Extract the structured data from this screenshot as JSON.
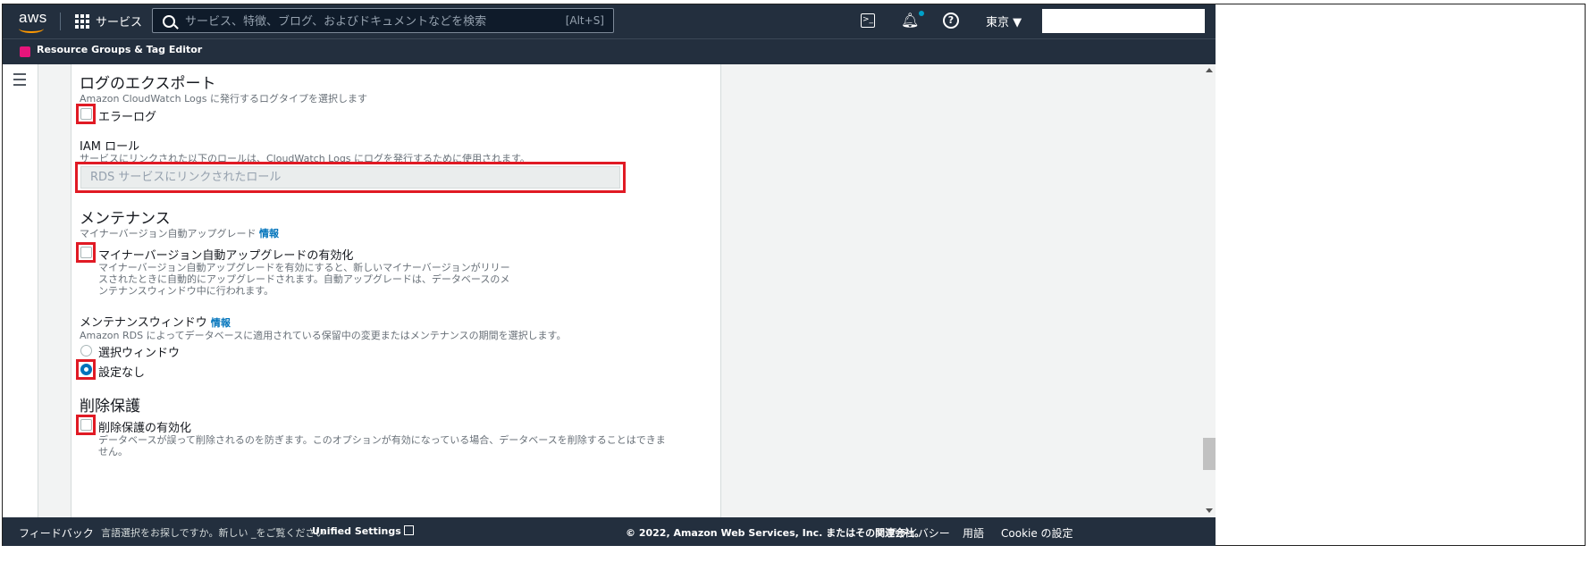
{
  "topbar": {
    "logo": "aws",
    "services_label": "サービス",
    "search_placeholder": "サービス、特徴、ブログ、およびドキュメントなどを検索",
    "search_shortcut": "[Alt+S]",
    "region_label": "東京 ▼",
    "icons": [
      "grid-icon",
      "search-icon",
      "cloudshell-icon",
      "bell-icon",
      "help-icon"
    ],
    "notification_dot_color": "#00a1c9"
  },
  "subbar": {
    "app_label": "Resource Groups & Tag Editor"
  },
  "log_export": {
    "heading": "ログのエクスポート",
    "description": "Amazon CloudWatch Logs に発行するログタイプを選択します",
    "error_log_label": "エラーログ",
    "error_log_checked": false
  },
  "iam_role": {
    "label": "IAM ロール",
    "description": "サービスにリンクされた以下のロールは、CloudWatch Logs にログを発行するために使用されます。",
    "input_placeholder": "RDS サービスにリンクされたロール"
  },
  "maintenance": {
    "heading": "メンテナンス",
    "subheading": "マイナーバージョン自動アップグレード",
    "info_link": "情報",
    "auto_upgrade_label": "マイナーバージョン自動アップグレードの有効化",
    "auto_upgrade_checked": false,
    "auto_upgrade_desc_1": "マイナーバージョン自動アップグレードを有効にすると、新しいマイナーバージョンがリリー",
    "auto_upgrade_desc_2": "スされたときに自動的にアップグレードされます。自動アップグレードは、データベースのメ",
    "auto_upgrade_desc_3": "ンテナンスウィンドウ中に行われます。"
  },
  "maintenance_window": {
    "label": "メンテナンスウィンドウ",
    "info_link": "情報",
    "description": "Amazon RDS によってデータベースに適用されている保留中の変更またはメンテナンスの期間を選択します。",
    "option_select": "選択ウィンドウ",
    "option_none": "設定なし",
    "selected": "設定なし"
  },
  "deletion_protection": {
    "heading": "削除保護",
    "checkbox_label": "削除保護の有効化",
    "checked": false,
    "desc_1": "データベースが誤って削除されるのを防ぎます。このオプションが有効になっている場合、データベースを削除することはできま",
    "desc_2": "せん。"
  },
  "footer": {
    "feedback": "フィードバック",
    "language_prompt": "言語選択をお探しですか。新しい _をご覧ください",
    "unified_settings": "Unified Settings",
    "copyright": "© 2022, Amazon Web Services, Inc. またはその関連会社。",
    "privacy": "プライバシー",
    "terms": "用語",
    "cookie": "Cookie の設定"
  },
  "colors": {
    "nav_bg": "#232f3e",
    "highlight_red": "#e01a24",
    "link_blue": "#0073bb",
    "aws_orange": "#ff9900"
  }
}
